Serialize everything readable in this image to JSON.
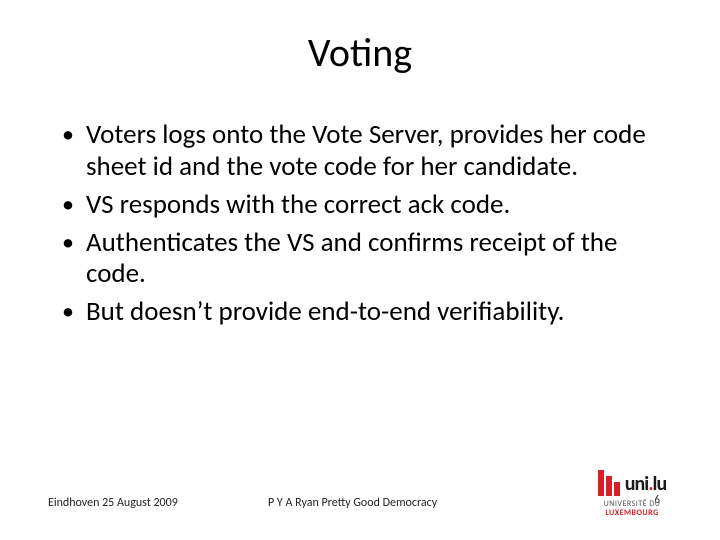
{
  "title": "Voting",
  "bullets": [
    "Voters logs onto the Vote Server, provides her code sheet id and the vote code for her candidate.",
    "VS responds with the correct ack code.",
    "Authenticates the VS and confirms receipt of the code.",
    "But doesn’t provide end-to-end verifiability."
  ],
  "footer": {
    "date": "Eindhoven 25 August 2009",
    "author": "P Y A Ryan Pretty Good Democracy",
    "page": "6"
  },
  "logo": {
    "word_part1": "uni",
    "word_dot": ".",
    "word_part2": "lu",
    "sub_line1": "UNIVERSITÉ DU",
    "sub_line2": "LUXEMBOURG"
  }
}
